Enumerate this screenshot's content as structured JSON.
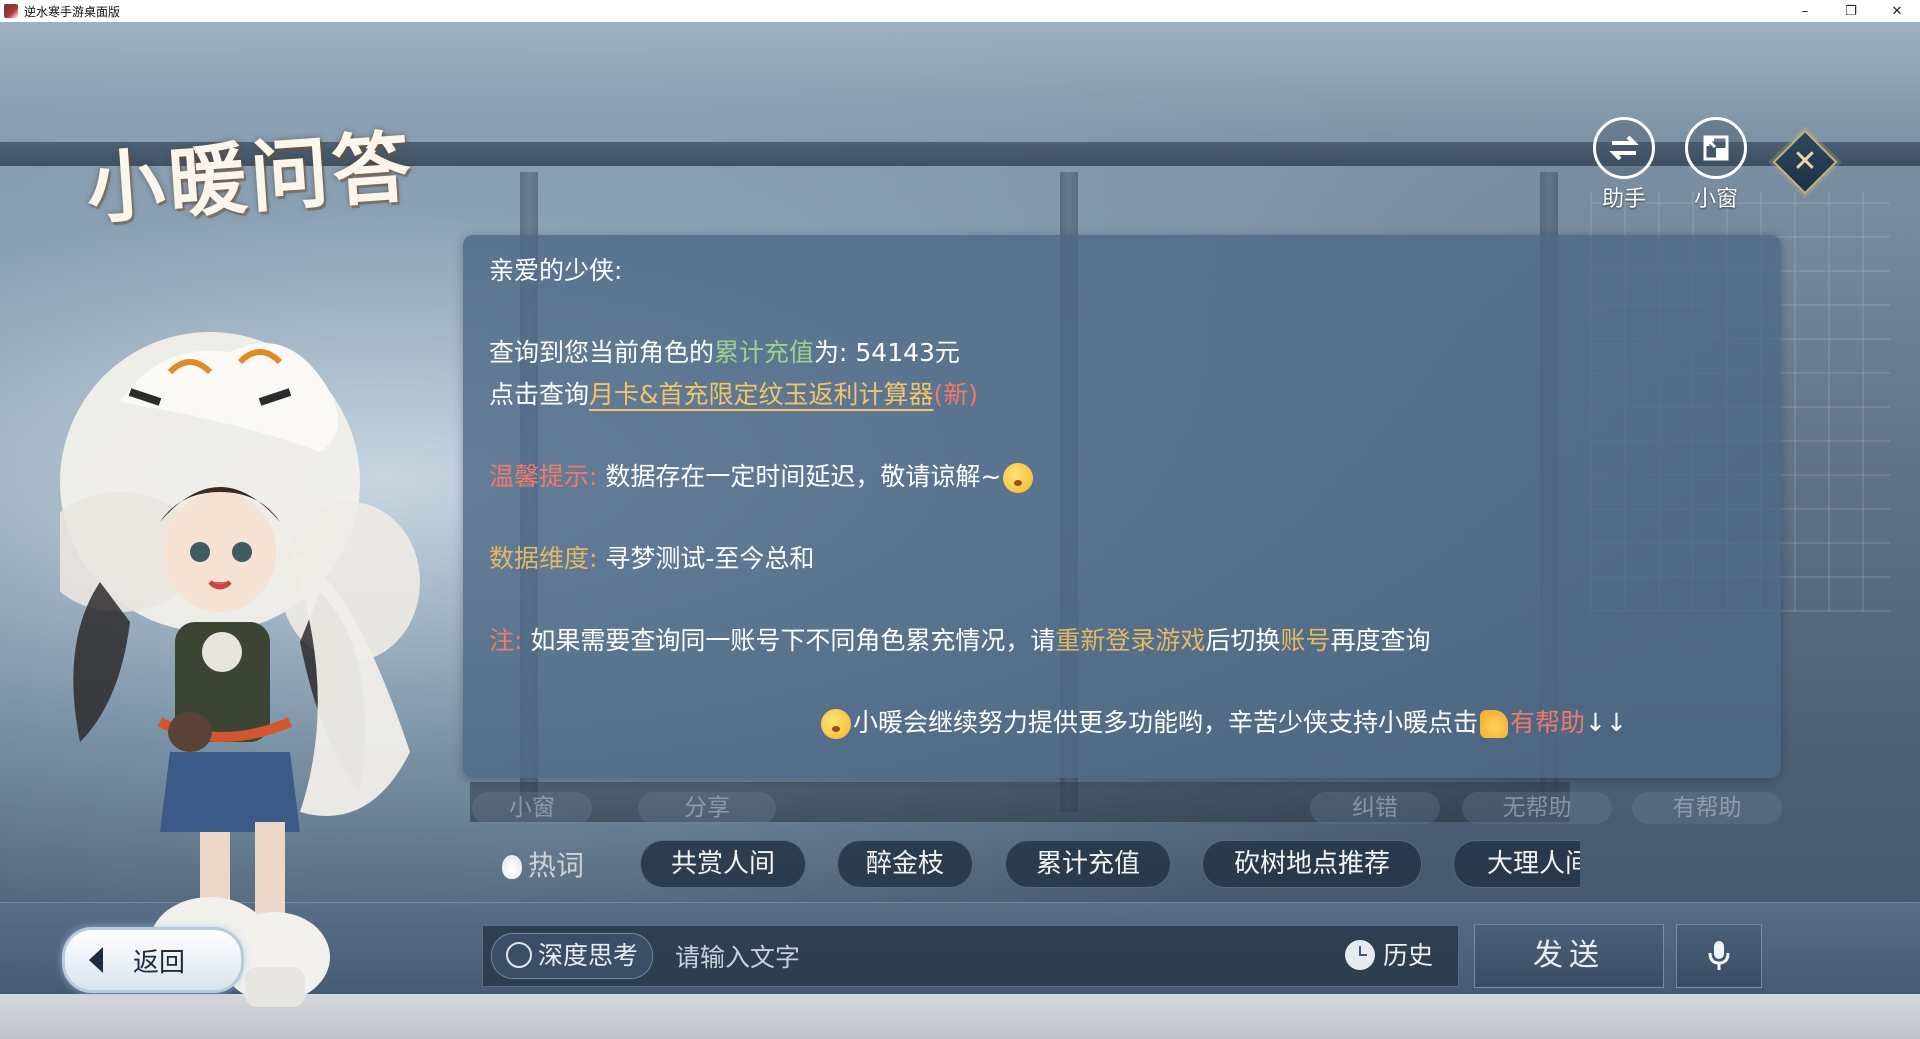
{
  "window": {
    "title": "逆水寒手游桌面版",
    "minimize": "–",
    "restore": "❐",
    "close": "✕"
  },
  "page": {
    "title": "小暖问答"
  },
  "top_buttons": [
    {
      "icon": "swap-arrows-icon",
      "label": "助手"
    },
    {
      "icon": "mini-window-icon",
      "label": "小窗"
    }
  ],
  "message": {
    "greeting": "亲爱的少侠:",
    "query_prefix": "查询到您当前角色的",
    "query_highlight": "累计充值",
    "query_mid": "为: ",
    "query_value": "54143元",
    "link_prefix": "点击查询",
    "link_text": "月卡&首充限定纹玉返利计算器",
    "link_new": "(新)",
    "tip_label": "温馨提示:",
    "tip_text": "数据存在一定时间延迟，敬请谅解~",
    "dimension_label": "数据维度:",
    "dimension_text": "寻梦测试-至今总和",
    "note_label": "注:",
    "note_text_1": "如果需要查询同一账号下不同角色累充情况，请",
    "note_highlight_1": "重新登录游戏",
    "note_text_2": "后切换",
    "note_highlight_2": "账号",
    "note_text_3": "再度查询",
    "footer_text": "小暖会继续努力提供更多功能哟，辛苦少侠支持小暖点击",
    "footer_helpful": "有帮助",
    "footer_arrows": "↓↓"
  },
  "actions": {
    "mini_window": "小窗",
    "share": "分享",
    "correct": "纠错",
    "not_helpful": "无帮助",
    "helpful": "有帮助"
  },
  "hot_words": {
    "label": "热词",
    "items": [
      "共赏人间",
      "醉金枝",
      "累计充值",
      "砍树地点推荐",
      "大理人间"
    ]
  },
  "back_button": {
    "label": "返回"
  },
  "input": {
    "deep_think_label": "深度思考",
    "placeholder": "请输入文字",
    "value": "",
    "history_label": "历史",
    "send_label": "发送"
  },
  "colors": {
    "bubble": "#4e6886",
    "gold": "#e3b866",
    "green": "#9ed08f",
    "red": "#f07a6a"
  }
}
